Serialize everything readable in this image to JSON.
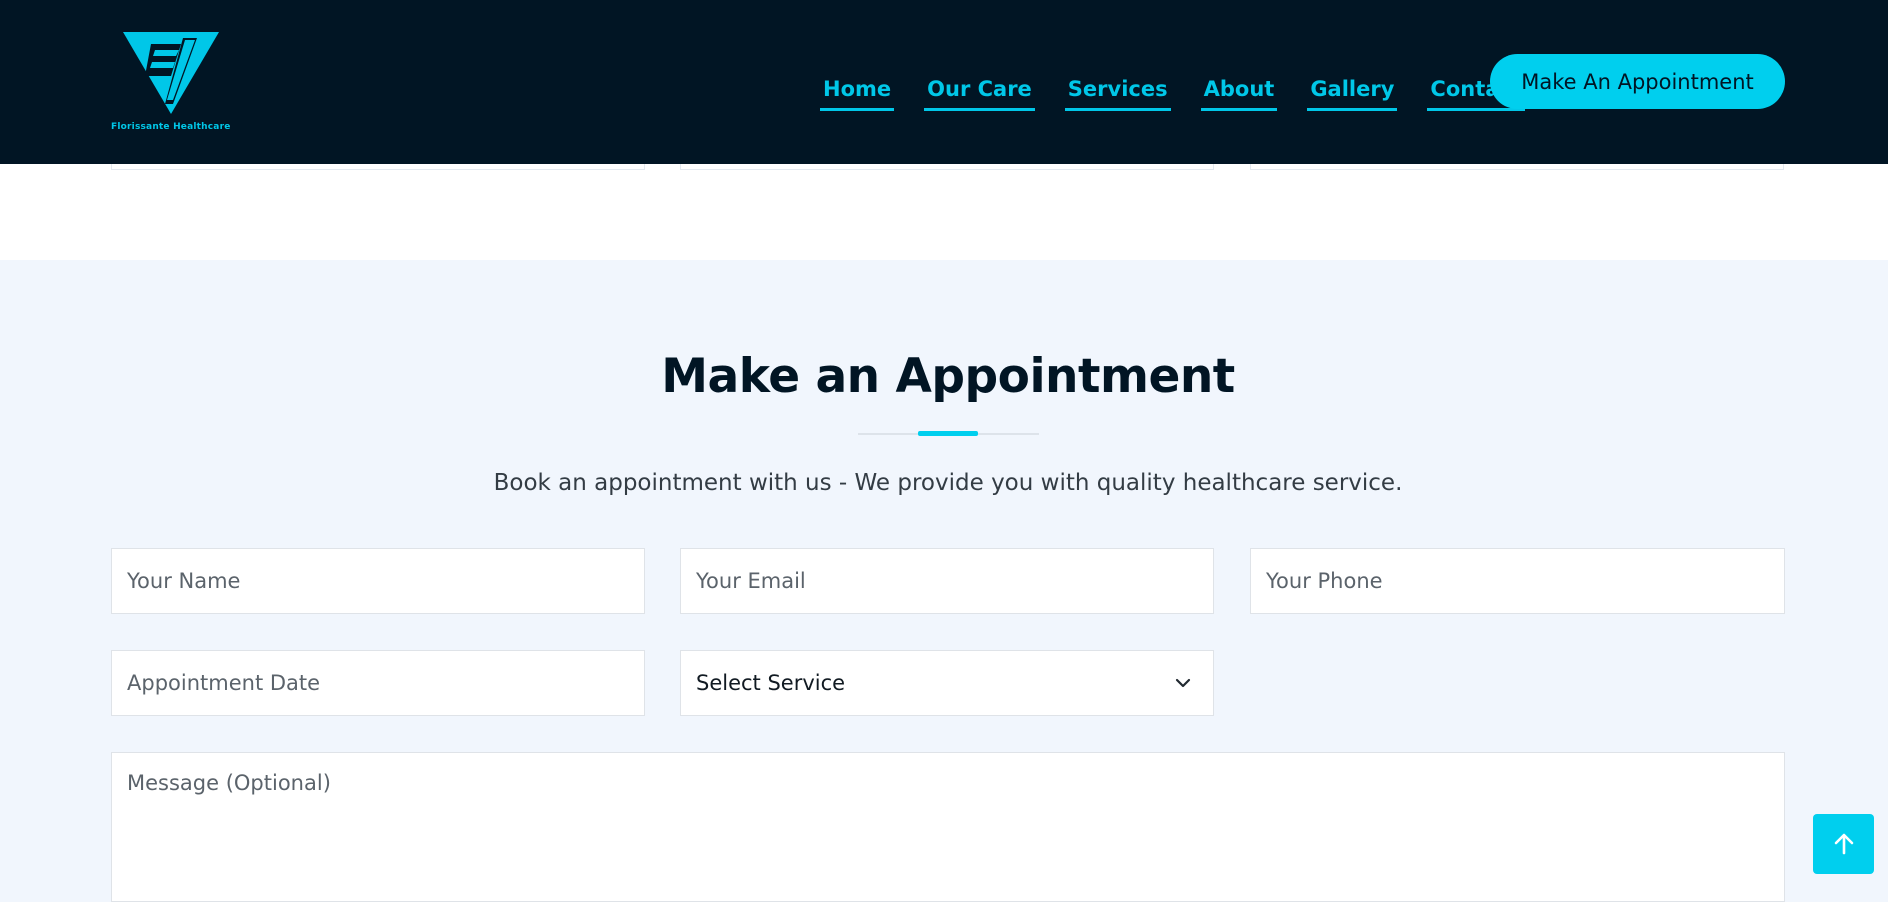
{
  "brand": {
    "name": "Florissante Healthcare",
    "accent": "#00cfee",
    "dark": "#011524"
  },
  "nav": {
    "items": [
      {
        "label": "Home"
      },
      {
        "label": "Our Care"
      },
      {
        "label": "Services"
      },
      {
        "label": "About"
      },
      {
        "label": "Gallery"
      },
      {
        "label": "Contact"
      }
    ],
    "cta_label": "Make An Appointment"
  },
  "appointment": {
    "title": "Make an Appointment",
    "subtitle": "Book an appointment with us - We provide you with quality healthcare service.",
    "fields": {
      "name_placeholder": "Your Name",
      "email_placeholder": "Your Email",
      "phone_placeholder": "Your Phone",
      "date_placeholder": "Appointment Date",
      "service_selected": "Select Service",
      "message_placeholder": "Message (Optional)"
    }
  },
  "icons": {
    "service_dropdown": "chevron-down-icon",
    "back_to_top": "arrow-up-icon"
  }
}
